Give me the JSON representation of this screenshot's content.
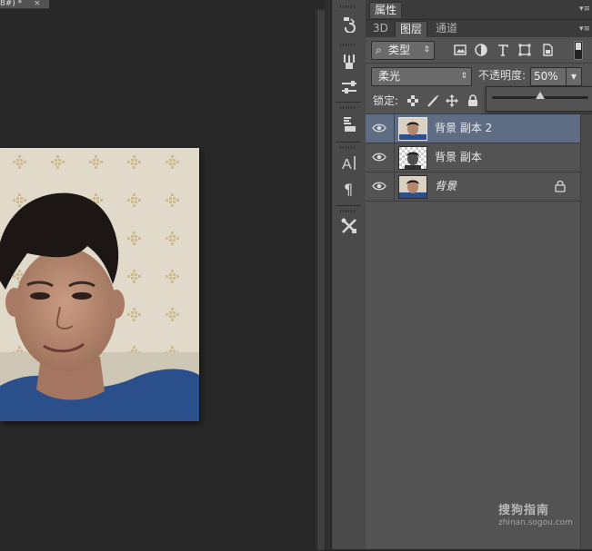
{
  "document": {
    "tab_title": "8#) *",
    "close_glyph": "×"
  },
  "properties_panel": {
    "tab_label": "属性"
  },
  "layers_panel": {
    "tabs": [
      "3D",
      "图层",
      "通道"
    ],
    "active_tab": "图层",
    "filter": {
      "kind_label": "类型",
      "kind_prefix": "⌕",
      "icons": [
        "image-filter-icon",
        "adjustment-filter-icon",
        "type-filter-icon",
        "shape-filter-icon",
        "smart-object-filter-icon"
      ]
    },
    "blend_mode": "柔光",
    "opacity_label": "不透明度:",
    "opacity_value": "50%",
    "opacity_slider_level": 0.5,
    "lock_label": "锁定:",
    "layers": [
      {
        "name": "背景 副本 2",
        "selected": true,
        "visible": true,
        "locked": false,
        "thumb": "photo"
      },
      {
        "name": "背景 副本",
        "selected": false,
        "visible": true,
        "locked": false,
        "thumb": "transparent-cutout"
      },
      {
        "name": "背景",
        "selected": false,
        "visible": true,
        "locked": true,
        "thumb": "photo"
      }
    ]
  },
  "colors": {
    "selected_layer": "#5e6d83",
    "panel_bg": "#535353",
    "canvas_bg": "#282828"
  },
  "watermark": {
    "title": "搜狗指南",
    "url": "zhinan.sogou.com"
  }
}
